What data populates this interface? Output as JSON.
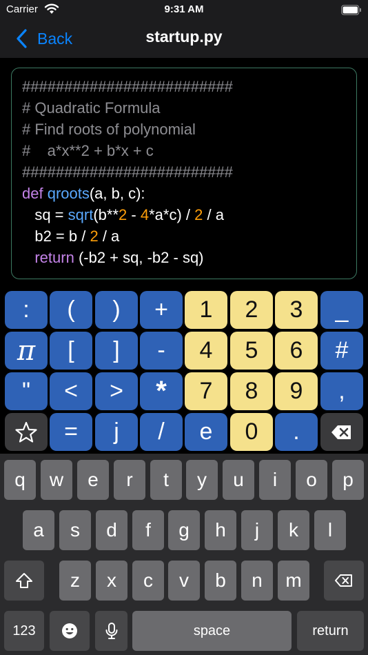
{
  "status": {
    "carrier": "Carrier",
    "time": "9:31 AM"
  },
  "nav": {
    "back_label": "Back",
    "title": "startup.py"
  },
  "code": {
    "l1": "#########################",
    "l2": "# Quadratic Formula",
    "l3": "# Find roots of polynomial",
    "l4": "#    a*x**2 + b*x + c",
    "l5": "#########################",
    "l6_def": "def",
    "l6_fn": " qroots",
    "l6_rest": "(a, b, c):",
    "l7_a": "   sq = ",
    "l7_fn": "sqrt",
    "l7_b": "(b**",
    "l7_n1": "2",
    "l7_c": " - ",
    "l7_n2": "4",
    "l7_d": "*a*c) / ",
    "l7_n3": "2",
    "l7_e": " / a",
    "l8_a": "   b2 = b / ",
    "l8_n": "2",
    "l8_b": " / a",
    "l9_ind": "   ",
    "l9_kw": "return",
    "l9_rest": " (-b2 + sq, -b2 - sq)"
  },
  "pad": {
    "row1": [
      ":",
      "(",
      ")",
      "+",
      "1",
      "2",
      "3",
      "_"
    ],
    "row2": [
      "π",
      "[",
      "]",
      "-",
      "4",
      "5",
      "6",
      "#"
    ],
    "row3": [
      "\"",
      "<",
      ">",
      "*",
      "7",
      "8",
      "9",
      ","
    ],
    "row4": [
      "j",
      "/",
      "e",
      "0",
      "."
    ],
    "row4_equals": "=",
    "star_icon": "star-icon",
    "delete_icon": "delete-icon"
  },
  "keyboard": {
    "row1": [
      "q",
      "w",
      "e",
      "r",
      "t",
      "y",
      "u",
      "i",
      "o",
      "p"
    ],
    "row2": [
      "a",
      "s",
      "d",
      "f",
      "g",
      "h",
      "j",
      "k",
      "l"
    ],
    "row3": [
      "z",
      "x",
      "c",
      "v",
      "b",
      "n",
      "m"
    ],
    "numbers_label": "123",
    "space_label": "space",
    "return_label": "return"
  },
  "colors": {
    "accent": "#0a84ff",
    "pad_blue": "#2f62b6",
    "pad_yellow": "#f5e18c",
    "editor_border": "#3d7a63"
  }
}
